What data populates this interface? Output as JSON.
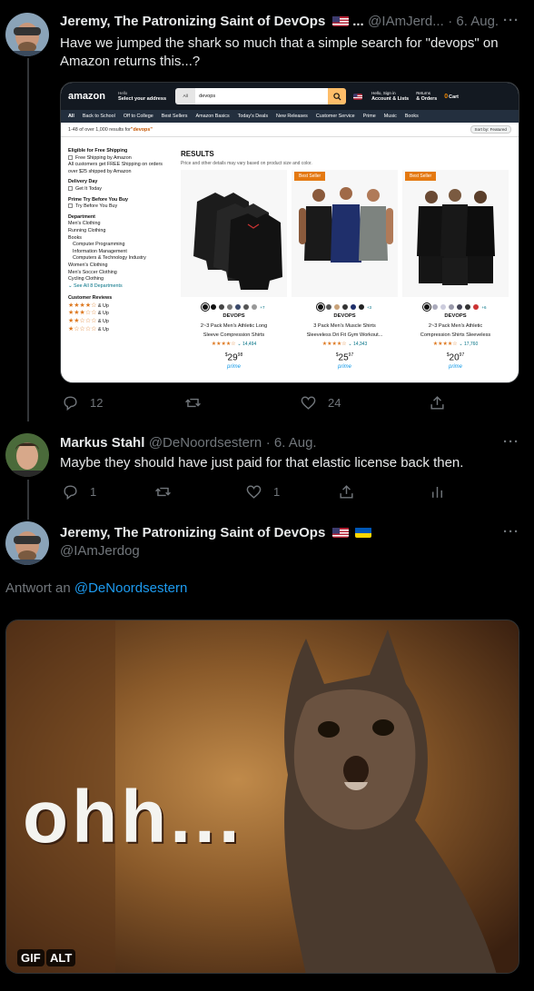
{
  "tweet1": {
    "author_name": "Jeremy, The Patronizing Saint of DevOps",
    "author_suffix": "...",
    "handle": "@IAmJerd...",
    "date": "· 6. Aug.",
    "text": "Have we jumped the shark so much that a simple search for \"devops\" on Amazon returns this...?",
    "reply_count": "12",
    "like_count": "24"
  },
  "amazon": {
    "logo": "amazon",
    "deliver_line1": "Hello",
    "deliver_line2": "Select your address",
    "search_category": "All",
    "search_value": "devops",
    "account_line1": "Hello, Sign in",
    "account_line2": "Account & Lists",
    "returns_line1": "Returns",
    "returns_line2": "& Orders",
    "cart_count": "0",
    "cart_label": "Cart",
    "nav": [
      "All",
      "Back to School",
      "Off to College",
      "Best Sellers",
      "Amazon Basics",
      "Today's Deals",
      "New Releases",
      "Customer Service",
      "Prime",
      "Music",
      "Books"
    ],
    "results_count": "1-48 of over 1,000 results for ",
    "results_query": "\"devops\"",
    "sort_label": "Sort by: Featured",
    "results_title": "RESULTS",
    "results_sub": "Price and other details may vary based on product size and color.",
    "sidebar": {
      "shipping_heading": "Eligible for Free Shipping",
      "shipping_option": "Free Shipping by Amazon",
      "shipping_note": "All customers get FREE Shipping on orders over $25 shipped by Amazon",
      "delivery_heading": "Delivery Day",
      "delivery_option": "Get It Today",
      "prime_heading": "Prime Try Before You Buy",
      "prime_option": "Try Before You Buy",
      "department_heading": "Department",
      "departments": [
        "Men's Clothing",
        "Running Clothing",
        "Books"
      ],
      "sub_departments": [
        "Computer Programming",
        "Information Management",
        "Computers & Technology Industry"
      ],
      "departments2": [
        "Women's Clothing",
        "Men's Soccer Clothing",
        "Cycling Clothing"
      ],
      "see_all": "See All 8 Departments",
      "reviews_heading": "Customer Reviews",
      "and_up": "& Up"
    },
    "products": [
      {
        "badge": "",
        "more_colors": "+7",
        "brand": "DEVOPS",
        "title1": "2~3 Pack Men's Athletic Long",
        "title2": "Sleeve Compression Shirts",
        "rating": "★★★★☆",
        "reviews": "14,494",
        "price_whole": "29",
        "price_frac": "98",
        "prime": "prime"
      },
      {
        "badge": "Best Seller",
        "more_colors": "+3",
        "brand": "DEVOPS",
        "title1": "3 Pack Men's Muscle Shirts",
        "title2": "Sleeveless Dri Fit Gym Workout...",
        "rating": "★★★★☆",
        "reviews": "14,343",
        "price_whole": "25",
        "price_frac": "97",
        "prime": "prime"
      },
      {
        "badge": "Best Seller",
        "more_colors": "+6",
        "brand": "DEVOPS",
        "title1": "2~3 Pack Men's Athletic",
        "title2": "Compression Shirts Sleeveless",
        "rating": "★★★★☆",
        "reviews": "17,760",
        "price_whole": "20",
        "price_frac": "97",
        "prime": "prime"
      }
    ]
  },
  "tweet2": {
    "author_name": "Markus Stahl",
    "handle": "@DeNoordsestern",
    "date": "· 6. Aug.",
    "text": "Maybe they should have just paid for that elastic license back then.",
    "reply_count": "1",
    "like_count": "1"
  },
  "tweet3": {
    "author_name": "Jeremy, The Patronizing Saint of DevOps",
    "handle": "@IAmJerdog",
    "reply_prefix": "Antwort an ",
    "reply_to": "@DeNoordsestern",
    "gif_text": "ohh...",
    "gif_tag": "GIF",
    "alt_tag": "ALT"
  }
}
